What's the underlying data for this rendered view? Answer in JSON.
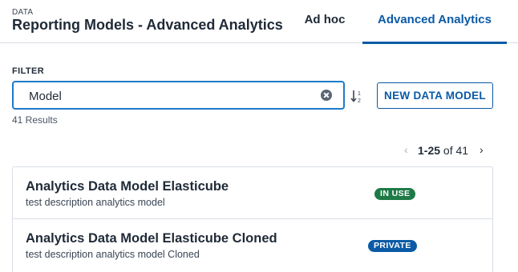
{
  "header": {
    "eyebrow": "DATA",
    "title": "Reporting Models - Advanced Analytics",
    "tabs": [
      {
        "label": "Ad hoc",
        "active": false
      },
      {
        "label": "Advanced Analytics",
        "active": true
      }
    ]
  },
  "filter": {
    "label": "FILTER",
    "value": "Model",
    "clear_icon": "clear-circle-icon",
    "sort_icon": "sort-down-icon",
    "results": "41 Results"
  },
  "actions": {
    "new_model_label": "NEW DATA MODEL"
  },
  "pagination": {
    "prev_glyph": "‹",
    "range": "1-25",
    "of_text": " of 41",
    "next_glyph": "›"
  },
  "models": [
    {
      "title": "Analytics Data Model Elasticube",
      "description": "test description analytics model",
      "status": "IN USE"
    },
    {
      "title": "Analytics Data Model Elasticube Cloned",
      "description": "test description analytics model Cloned",
      "status": "PRIVATE"
    }
  ],
  "colors": {
    "accent": "#0b5aa6",
    "in_use": "#1e7a46",
    "private": "#0b5aa6",
    "focus_border": "#1f7ac9"
  }
}
